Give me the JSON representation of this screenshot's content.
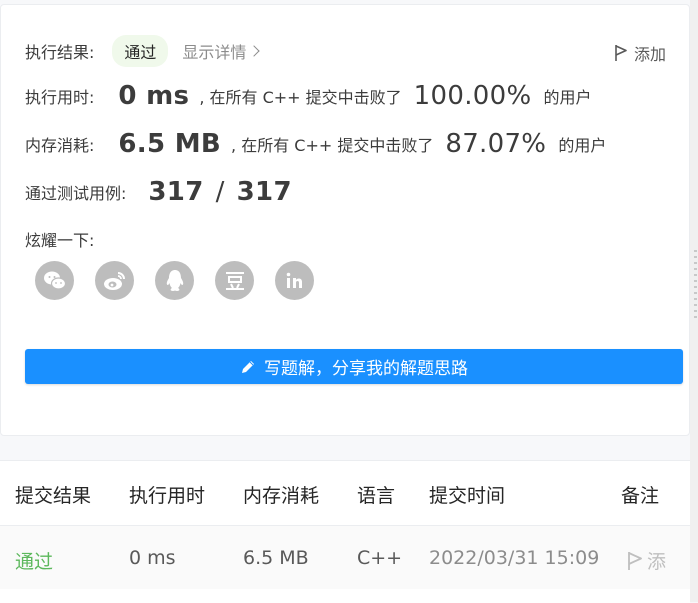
{
  "result": {
    "status_label": "执行结果:",
    "status": "通过",
    "detail_link": "显示详情",
    "add_note": "添加"
  },
  "runtime": {
    "label": "执行用时:",
    "value": "0 ms",
    "beat_prefix": ", 在所有 C++ 提交中击败了",
    "percent": "100.00%",
    "suffix": "的用户"
  },
  "memory": {
    "label": "内存消耗:",
    "value": "6.5 MB",
    "beat_prefix": ", 在所有 C++ 提交中击败了",
    "percent": "87.07%",
    "suffix": "的用户"
  },
  "tests": {
    "label": "通过测试用例:",
    "passed": "317",
    "sep": "/",
    "total": "317"
  },
  "share": {
    "label": "炫耀一下:",
    "icons": [
      "wechat-icon",
      "weibo-icon",
      "qq-icon",
      "douban-icon",
      "linkedin-icon"
    ]
  },
  "write_solution": "写题解，分享我的解题思路",
  "table": {
    "headers": [
      "提交结果",
      "执行用时",
      "内存消耗",
      "语言",
      "提交时间",
      "备注"
    ],
    "rows": [
      {
        "result": "通过",
        "runtime": "0 ms",
        "memory": "6.5 MB",
        "language": "C++",
        "time": "2022/03/31 15:09",
        "note": "添"
      }
    ]
  },
  "colors": {
    "accent": "#1a90ff",
    "pass": "#5cb85c",
    "badge_bg": "#f0f9eb"
  }
}
